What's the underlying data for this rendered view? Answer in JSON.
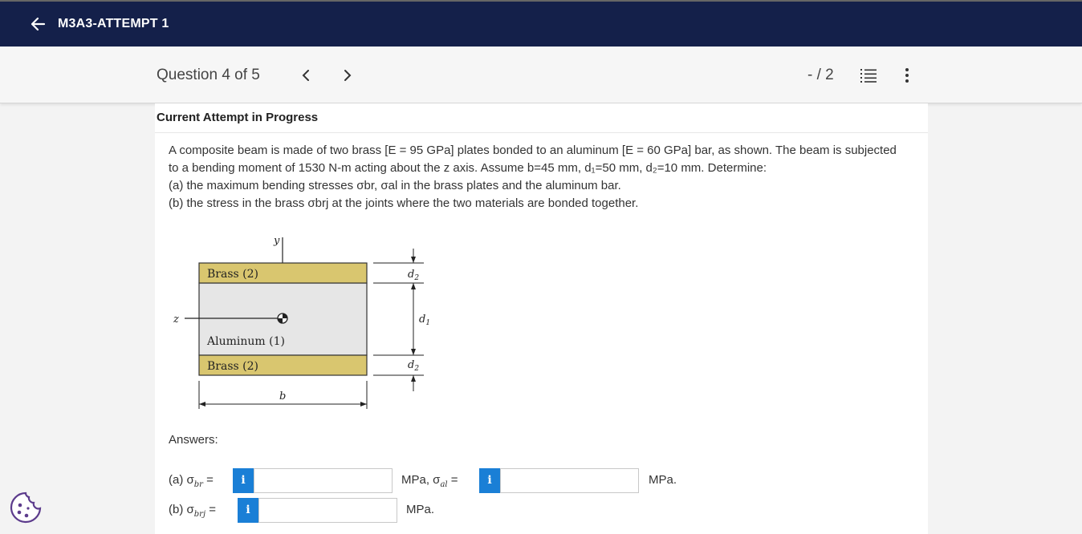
{
  "header": {
    "assignment_title": "M3A3-ATTEMPT 1"
  },
  "question_bar": {
    "title": "Question 4 of 5",
    "score": "- / 2"
  },
  "content": {
    "attempt_status": "Current Attempt in Progress",
    "problem": {
      "line1": "A composite beam is made of two brass [E = 95 GPa] plates bonded to an aluminum [E = 60 GPa] bar, as shown. The beam is subjected",
      "line2": "to a bending moment of 1530 N-m acting about the z axis. Assume b=45 mm, d₁=50 mm, d₂=10 mm. Determine:",
      "line3": "(a) the maximum bending stresses σbr, σal in the brass plates and the aluminum bar.",
      "line4": "(b) the stress in the brass σbrj at the joints where the two materials are bonded together."
    },
    "figure": {
      "brass_top": "Brass (2)",
      "aluminum": "Aluminum (1)",
      "brass_bottom": "Brass (2)",
      "y_axis": "y",
      "z_axis": "z",
      "width_label": "b",
      "d1": "d",
      "d1_sub": "1",
      "d2": "d",
      "d2_sub": "2",
      "brass_color": "#d9c66f",
      "aluminum_color": "#e6e6e6"
    },
    "answers": {
      "label": "Answers:",
      "a_label": "(a) σ",
      "a_sub": "br",
      "a_eq": " =",
      "a_value": "",
      "a_unit_mid": "MPa, σ",
      "a_sub2": "al",
      "a_eq2": " =",
      "a_value2": "",
      "a_unit": "MPa.",
      "b_label": "(b) σ",
      "b_sub": "brj",
      "b_eq": " =",
      "b_value": "",
      "b_unit": "MPa.",
      "info_glyph": "i"
    }
  },
  "colors": {
    "header_bg": "#14204a",
    "info_button": "#1a7fd6",
    "cookie_accent": "#5c3b8c"
  },
  "icons": [
    "arrow-left-icon",
    "chevron-left-icon",
    "chevron-right-icon",
    "numbered-list-icon",
    "more-vertical-icon",
    "cookie-icon"
  ]
}
